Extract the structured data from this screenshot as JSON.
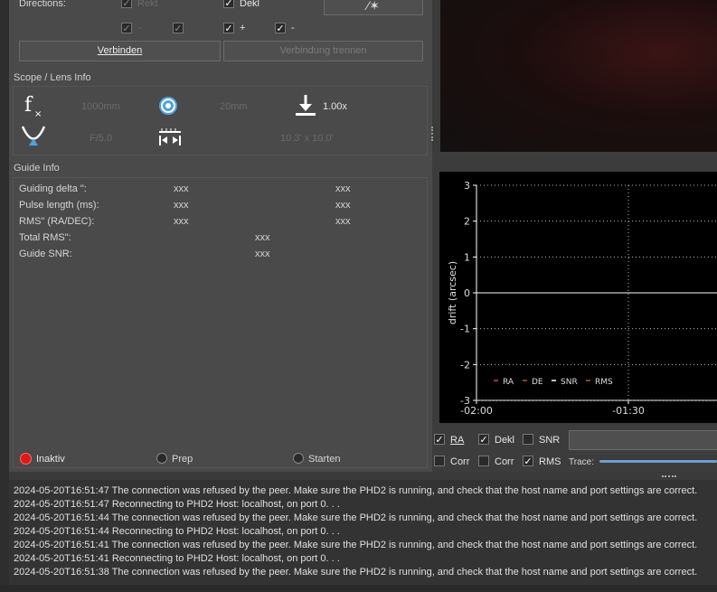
{
  "directions": {
    "label": "Directions:",
    "row1": [
      {
        "label": "Rekt",
        "checked": true,
        "enabled": false
      },
      {
        "label": "Dekl",
        "checked": true,
        "enabled": true
      }
    ],
    "row2": [
      {
        "label": "-",
        "checked": true,
        "enabled": false
      },
      {
        "label": "",
        "checked": true,
        "enabled": false
      },
      {
        "label": "+",
        "checked": true,
        "enabled": true
      },
      {
        "label": "-",
        "checked": true,
        "enabled": true
      }
    ]
  },
  "buttons": {
    "connect": "Verbinden",
    "disconnect": "Verbindung trennen"
  },
  "scope": {
    "title": "Scope / Lens Info",
    "focal_length": "1000mm",
    "aperture": "20mm",
    "reducer": "1.00x",
    "fratio": "F/5.0",
    "fov": "10.3' x 10.0'"
  },
  "guide_info": {
    "title": "Guide Info",
    "rows": [
      {
        "label": "Guiding delta \":",
        "v1": "xxx",
        "v2": "xxx"
      },
      {
        "label": "Pulse length (ms):",
        "v1": "xxx",
        "v2": "xxx"
      },
      {
        "label": "RMS\" (RA/DEC):",
        "v1": "xxx",
        "v2": "xxx"
      }
    ],
    "single_rows": [
      {
        "label": "Total RMS\":",
        "v": "xxx"
      },
      {
        "label": "Guide SNR:",
        "v": "xxx"
      }
    ]
  },
  "status": {
    "inactive": "Inaktiv",
    "prep": "Prep",
    "start": "Starten"
  },
  "chart_data": {
    "type": "line",
    "ylabel": "drift (arcsec)",
    "yticks": [
      "3",
      "2",
      "1",
      "0",
      "-1",
      "-2",
      "-3"
    ],
    "xticks": [
      "-02:00",
      "-01:30"
    ],
    "ylim": [
      -3,
      3
    ],
    "legend": [
      "RA",
      "DE",
      "SNR",
      "RMS"
    ],
    "series": []
  },
  "graph_controls": {
    "ra": {
      "label": "RA",
      "checked": true
    },
    "dekl": {
      "label": "Dekl",
      "checked": true
    },
    "snr": {
      "label": "SNR",
      "checked": false
    },
    "corr1": {
      "label": "Corr",
      "checked": false
    },
    "corr2": {
      "label": "Corr",
      "checked": false
    },
    "rms": {
      "label": "RMS",
      "checked": true
    },
    "trace_label": "Trace:"
  },
  "log": [
    "2024-05-20T16:51:47 The connection was refused by the peer. Make sure the PHD2 is running, and check that the host name and port settings are correct.",
    "2024-05-20T16:51:47 Reconnecting to PHD2 Host: localhost, on port 0. . .",
    "2024-05-20T16:51:44 The connection was refused by the peer. Make sure the PHD2 is running, and check that the host name and port settings are correct.",
    "2024-05-20T16:51:44 Reconnecting to PHD2 Host: localhost, on port 0. . .",
    "2024-05-20T16:51:41 The connection was refused by the peer. Make sure the PHD2 is running, and check that the host name and port settings are correct.",
    "2024-05-20T16:51:41 Reconnecting to PHD2 Host: localhost, on port 0. . .",
    "2024-05-20T16:51:38 The connection was refused by the peer. Make sure the PHD2 is running, and check that the host name and port settings are correct."
  ]
}
